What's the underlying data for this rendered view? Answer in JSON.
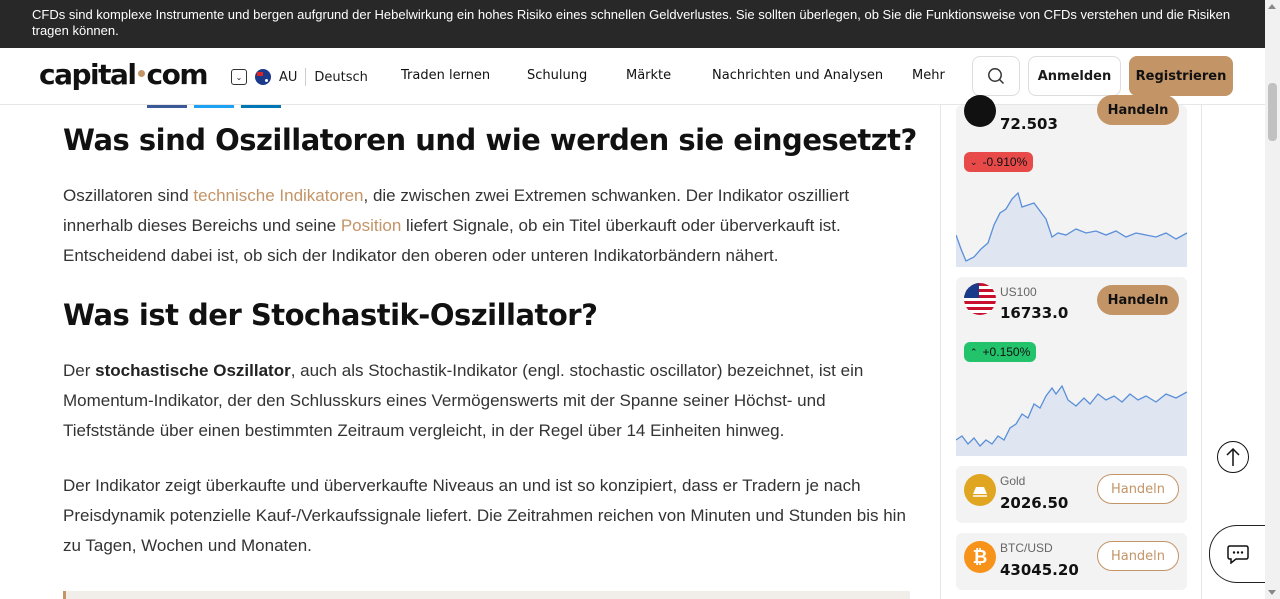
{
  "risk_warning": "CFDs sind komplexe Instrumente und bergen aufgrund der Hebelwirkung ein hohes Risiko eines schnellen Geldverlustes. Sie sollten überlegen, ob Sie die Funktionsweise von CFDs verstehen und die Risiken tragen können.",
  "header": {
    "logo_left": "capital",
    "logo_right": "com",
    "region": "AU",
    "language": "Deutsch",
    "nav": [
      "Traden lernen",
      "Schulung",
      "Märkte",
      "Nachrichten und Analysen",
      "Mehr"
    ],
    "login": "Anmelden",
    "register": "Registrieren"
  },
  "article": {
    "h_oscillators": "Was sind Oszillatoren und wie werden sie eingesetzt?",
    "p1_a": "Oszillatoren sind ",
    "p1_link1": "technische Indikatoren",
    "p1_b": ", die zwischen zwei Extremen schwanken. Der Indikator oszilliert innerhalb dieses Bereichs und seine ",
    "p1_link2": "Position",
    "p1_c": " liefert Signale, ob ein Titel überkauft oder überverkauft ist. Entscheidend dabei ist, ob sich der Indikator den oberen oder unteren Indikatorbändern nähert.",
    "h_stochastic": "Was ist der Stochastik-Oszillator?",
    "p2_a": "Der ",
    "p2_bold": "stochastische Oszillator",
    "p2_b": ", auch als Stochastik-Indikator (engl. stochastic oscillator) bezeichnet, ist ein Momentum-Indikator, der den Schlusskurs eines Vermögenswerts mit der Spanne seiner Höchst- und Tiefststände über einen bestimmten Zeitraum vergleicht, in der Regel über 14 Einheiten hinweg.",
    "p3": "Der Indikator zeigt überkaufte und überverkaufte Niveaus an und ist so konzipiert, dass er Tradern je nach Preisdynamik potenzielle Kauf-/Verkaufssignale liefert. Die Zeitrahmen reichen von Minuten und Stunden bis hin zu Tagen, Wochen und Monaten."
  },
  "sidebar": {
    "trade_label": "Handeln",
    "markets": [
      {
        "ticker": "",
        "price": "72.503",
        "change": "-0.910%",
        "direction": "down"
      },
      {
        "ticker": "US100",
        "price": "16733.0",
        "change": "+0.150%",
        "direction": "up"
      },
      {
        "ticker": "Gold",
        "price": "2026.50"
      },
      {
        "ticker": "BTC/USD",
        "price": "43045.20"
      }
    ]
  },
  "colors": {
    "accent": "#c39466",
    "negative": "#e84a4a",
    "positive": "#22c36b",
    "banner": "#282828"
  }
}
